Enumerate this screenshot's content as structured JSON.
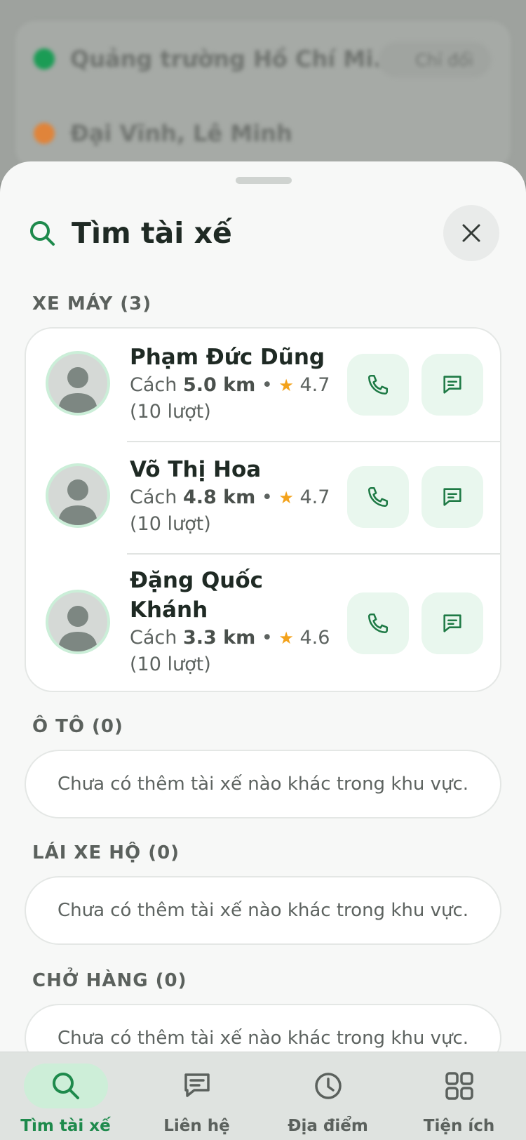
{
  "background": {
    "origin_text": "Quảng trường Hồ Chí Mi...",
    "origin_action": "Chỉ đổi",
    "destination_text": "Đại Vĩnh, Lê Minh"
  },
  "sheet": {
    "title": "Tìm tài xế",
    "close_icon": "close-icon"
  },
  "sections": {
    "motorbike": {
      "label": "XE MÁY (3)",
      "drivers": [
        {
          "name": "Phạm Đức Dũng",
          "distance_prefix": "Cách ",
          "distance": "5.0 km",
          "rating": "4.7",
          "trips": "(10 lượt)"
        },
        {
          "name": "Võ Thị Hoa",
          "distance_prefix": "Cách ",
          "distance": "4.8 km",
          "rating": "4.7",
          "trips": "(10 lượt)"
        },
        {
          "name_line1": "Đặng Quốc",
          "name_line2": "Khánh",
          "distance_prefix": "Cách ",
          "distance": "3.3 km",
          "rating": "4.6",
          "trips": "(10 lượt)"
        }
      ]
    },
    "car": {
      "label": "Ô TÔ (0)",
      "empty": "Chưa có thêm tài xế nào khác trong khu vực."
    },
    "chauffeur": {
      "label": "LÁI XE HỘ (0)",
      "empty": "Chưa có thêm tài xế nào khác trong khu vực."
    },
    "cargo": {
      "label": "CHỞ HÀNG (0)",
      "empty": "Chưa có thêm tài xế nào khác trong khu vực."
    }
  },
  "nav": {
    "items": [
      {
        "label": "Tìm tài xế",
        "icon": "search-icon",
        "active": true
      },
      {
        "label": "Liên hệ",
        "icon": "chat-icon",
        "active": false
      },
      {
        "label": "Địa điểm",
        "icon": "clock-icon",
        "active": false
      },
      {
        "label": "Tiện ích",
        "icon": "grid-icon",
        "active": false
      }
    ]
  },
  "colors": {
    "accent": "#1e8a4c",
    "accent_light": "#e9f7ee",
    "star": "#f3a21b",
    "sheet_bg": "#f7f8f7"
  }
}
